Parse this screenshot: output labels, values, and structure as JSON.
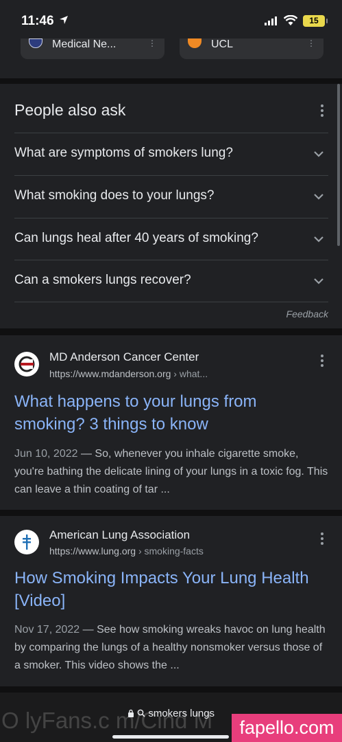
{
  "status_bar": {
    "time": "11:46",
    "battery": "15"
  },
  "top_cards": [
    {
      "label": "Medical Ne..."
    },
    {
      "label": "UCL"
    }
  ],
  "people_also_ask": {
    "title": "People also ask",
    "questions": [
      "What are symptoms of smokers lung?",
      "What smoking does to your lungs?",
      "Can lungs heal after 40 years of smoking?",
      "Can a smokers lungs recover?"
    ],
    "feedback": "Feedback"
  },
  "results": [
    {
      "site": "MD Anderson Cancer Center",
      "url": "https://www.mdanderson.org",
      "path": " › what...",
      "title": "What happens to your lungs from smoking? 3 things to know",
      "date": "Jun 10, 2022",
      "snippet": " — So, whenever you inhale cigarette smoke, you're bathing the delicate lining of your lungs in a toxic fog. This can leave a thin coating of tar ..."
    },
    {
      "site": "American Lung Association",
      "url": "https://www.lung.org",
      "path": " › smoking-facts",
      "title": "How Smoking Impacts Your Lung Health [Video]",
      "date": "Nov 17, 2022",
      "snippet": " — See how smoking wreaks havoc on lung health by comparing the lungs of a healthy nonsmoker versus those of a smoker. This video shows the ..."
    }
  ],
  "address_bar": {
    "query": "smokers lungs"
  },
  "overlays": {
    "watermark": "O lyFans.c m/Cind M",
    "badge": "fapello.com"
  },
  "colors": {
    "background": "#202124",
    "link": "#8ab4f8",
    "text": "#e8eaed",
    "muted": "#9aa0a6"
  }
}
